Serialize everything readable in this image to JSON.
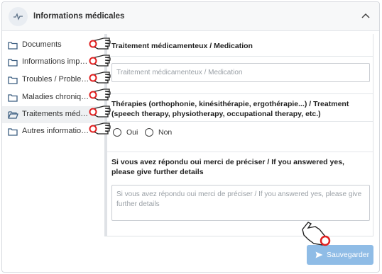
{
  "header": {
    "title": "Informations médicales",
    "icon": "heartbeat-icon",
    "chevron": "chevron-up-icon"
  },
  "sidebar": {
    "items": [
      {
        "label": "Documents",
        "icon": "folder-icon",
        "active": false
      },
      {
        "label": "Informations importa...",
        "icon": "folder-icon",
        "active": false
      },
      {
        "label": "Troubles / Problems...",
        "icon": "folder-icon",
        "active": false
      },
      {
        "label": "Maladies chronique...",
        "icon": "folder-icon",
        "active": false
      },
      {
        "label": "Traitements médica...",
        "icon": "folder-open-icon",
        "active": true
      },
      {
        "label": "Autres informations...",
        "icon": "folder-icon",
        "active": false
      }
    ]
  },
  "main": {
    "medication": {
      "title": "Traitement médicamenteux / Medication",
      "placeholder": "Traitement médicamenteux / Medication"
    },
    "therapies": {
      "title": "Thérapies (orthophonie, kinésithérapie, ergothérapie...) / Treatment (speech therapy, physiotherapy, occupational therapy, etc.)",
      "options": [
        "Oui",
        "Non"
      ]
    },
    "details": {
      "title": "Si vous avez répondu oui merci de préciser / If you answered yes, please give further details",
      "placeholder": "Si vous avez répondu oui merci de préciser / If you answered yes, please give further details"
    }
  },
  "footer": {
    "save_label": "Sauvegarder",
    "save_icon": "send-icon"
  },
  "colors": {
    "accent": "#8fbce6",
    "annotation": "#e02020"
  }
}
